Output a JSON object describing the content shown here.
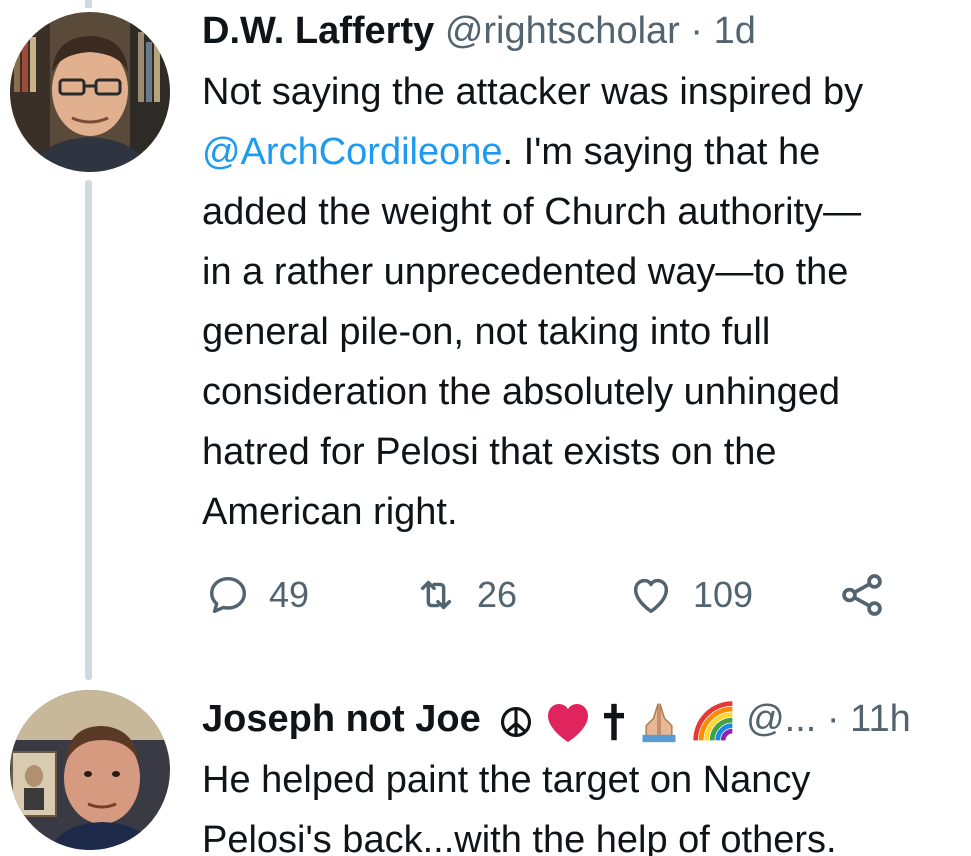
{
  "tweet1": {
    "display_name": "D.W. Lafferty",
    "handle": "@rightscholar",
    "separator": "·",
    "time": "1d",
    "lines": [
      {
        "text": "Not saying the attacker was inspired by"
      },
      {
        "mention": "@ArchCordileone",
        "rest": ". I'm saying that he"
      },
      {
        "text": "added the weight of Church authority—"
      },
      {
        "text": "in a rather unprecedented way—to the"
      },
      {
        "text": "general pile-on, not taking into full"
      },
      {
        "text": "consideration the absolutely unhinged"
      },
      {
        "text": "hatred for Pelosi that exists on the"
      },
      {
        "text": "American right."
      }
    ],
    "replies": "49",
    "retweets": "26",
    "likes": "109"
  },
  "tweet2": {
    "display_name": "Joseph not Joe",
    "name_emoji": [
      "peace-symbol",
      "red-heart",
      "latin-cross",
      "folded-hands",
      "rainbow"
    ],
    "handle": "@...",
    "separator": "·",
    "time": "11h",
    "lines": [
      {
        "text": "He helped paint the target on Nancy"
      },
      {
        "text": "Pelosi's back...with the help of others."
      }
    ]
  },
  "icons": {
    "reply": "reply-bubble-icon",
    "retweet": "retweet-arrows-icon",
    "like": "heart-outline-icon",
    "share": "share-nodes-icon"
  },
  "colors": {
    "text": "#0f1419",
    "secondary": "#536471",
    "link": "#1d9bf0",
    "thread_line": "#cfd9de"
  }
}
